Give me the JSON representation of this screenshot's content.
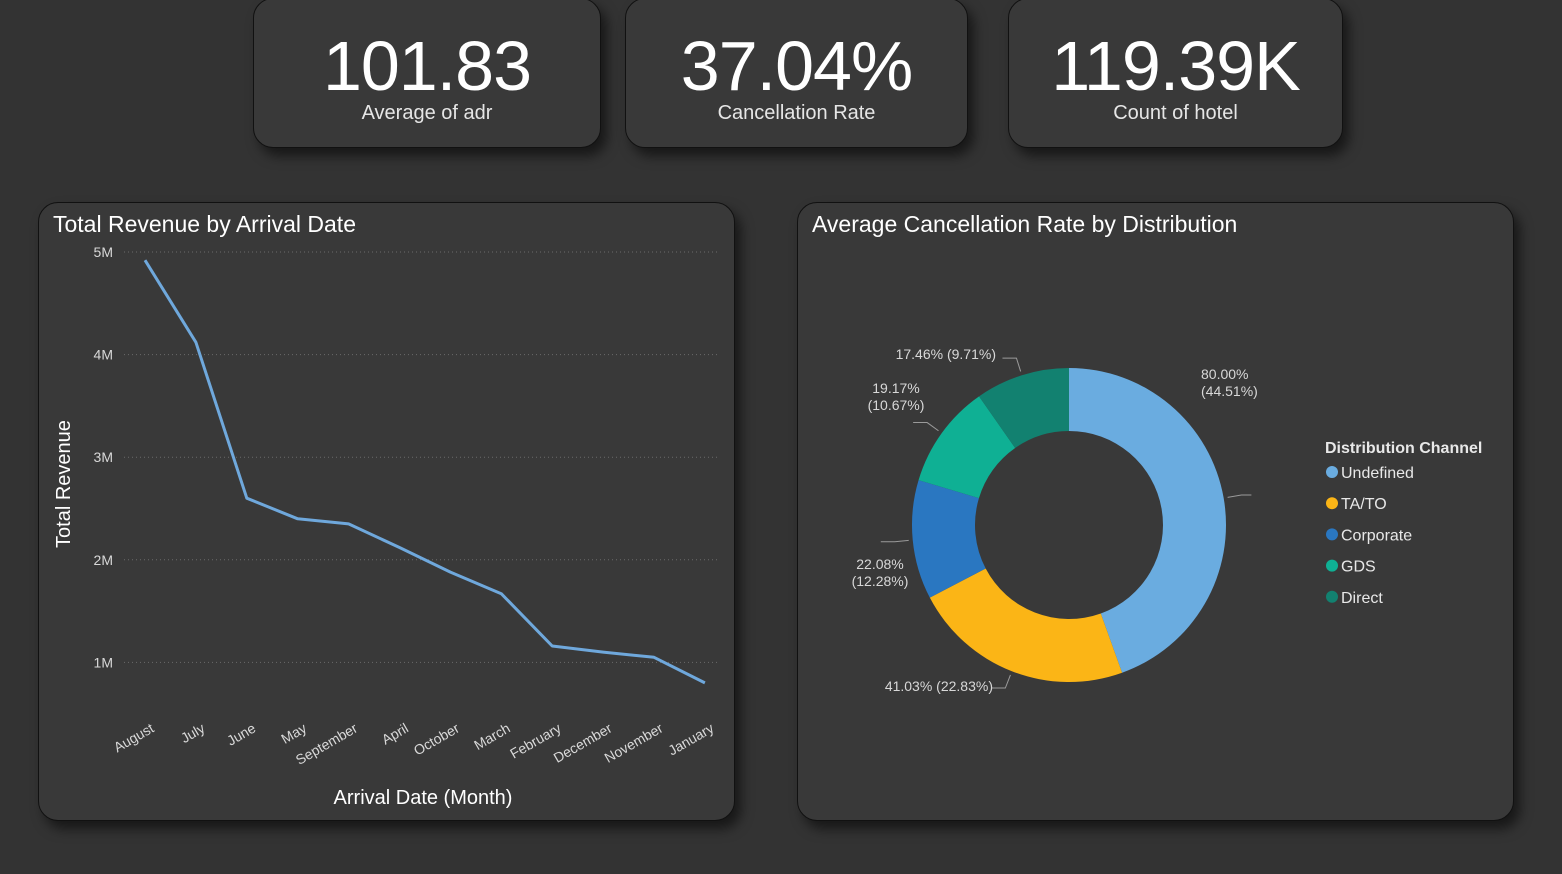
{
  "kpis": [
    {
      "value": "101.83",
      "label": "Average of adr"
    },
    {
      "value": "37.04%",
      "label": "Cancellation Rate"
    },
    {
      "value": "119.39K",
      "label": "Count of hotel"
    }
  ],
  "colors": {
    "line": "#6fa8dc",
    "undefined": "#6aace0",
    "tato": "#fbb516",
    "corporate": "#2a77c1",
    "gds": "#0fb094",
    "direct": "#128170"
  },
  "chart_data": [
    {
      "type": "line",
      "title": "Total Revenue by Arrival Date",
      "xlabel": "Arrival Date (Month)",
      "ylabel": "Total Revenue",
      "categories": [
        "August",
        "July",
        "June",
        "May",
        "September",
        "April",
        "October",
        "March",
        "February",
        "December",
        "November",
        "January"
      ],
      "values": [
        4.92,
        4.12,
        2.6,
        2.4,
        2.35,
        2.12,
        1.88,
        1.67,
        1.16,
        1.1,
        1.05,
        0.8
      ],
      "ylim": [
        0,
        5
      ],
      "yticks": [
        1,
        2,
        3,
        4,
        5
      ],
      "ytick_labels": [
        "1M",
        "2M",
        "3M",
        "4M",
        "5M"
      ],
      "grid": true
    },
    {
      "type": "pie",
      "title": "Average Cancellation Rate by Distribution",
      "legend_title": "Distribution Channel",
      "legend_position": "right",
      "slices": [
        {
          "name": "Undefined",
          "value": 80.0,
          "share": 44.51,
          "label_value": "80.00%",
          "label_share": "(44.51%)",
          "color": "#6aace0"
        },
        {
          "name": "TA/TO",
          "value": 41.03,
          "share": 22.83,
          "label_value": "41.03%",
          "label_share": "(22.83%)",
          "color": "#fbb516"
        },
        {
          "name": "Corporate",
          "value": 22.08,
          "share": 12.28,
          "label_value": "22.08%",
          "label_share": "(12.28%)",
          "color": "#2a77c1"
        },
        {
          "name": "GDS",
          "value": 19.17,
          "share": 10.67,
          "label_value": "19.17%",
          "label_share": "(10.67%)",
          "color": "#0fb094"
        },
        {
          "name": "Direct",
          "value": 17.46,
          "share": 9.71,
          "label_value": "17.46%",
          "label_share": "(9.71%)",
          "color": "#128170"
        }
      ]
    }
  ]
}
